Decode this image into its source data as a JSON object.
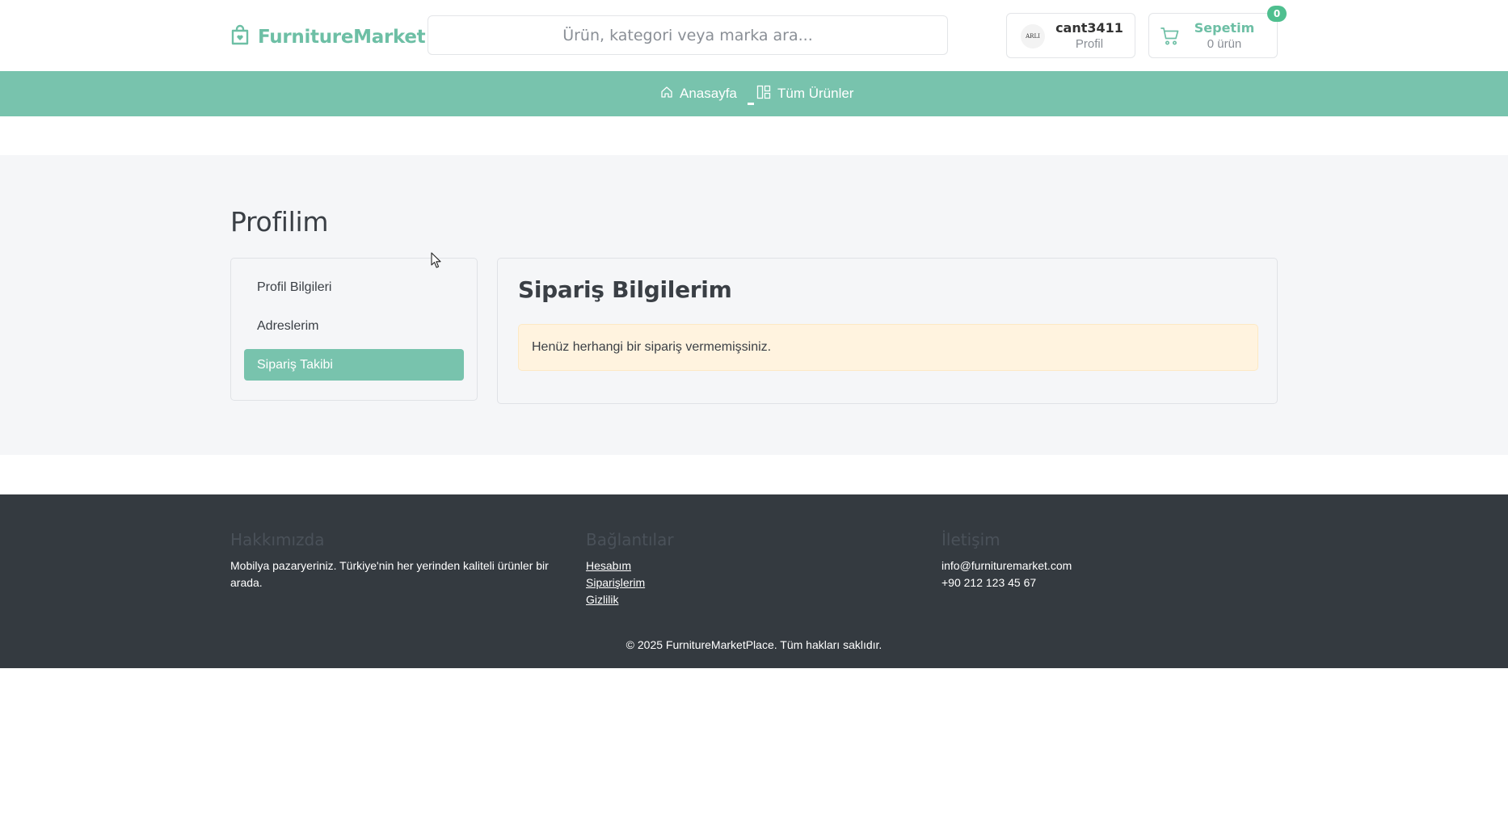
{
  "header": {
    "brand": "FurnitureMarket",
    "brand_color": "#6dbfa5",
    "brand_icon": "shopping-bag-icon",
    "search": {
      "placeholder": "Ürün, kategori veya marka ara...",
      "value": ""
    },
    "profile": {
      "username": "cant3411",
      "label": "Profil",
      "avatar_text": "ARLI"
    },
    "cart": {
      "title": "Sepetim",
      "subtitle": "0 ürün",
      "badge": "0",
      "icon": "cart-icon"
    }
  },
  "nav": {
    "color": "#78c3ad",
    "items": [
      {
        "label": "Anasayfa",
        "icon": "home-icon"
      },
      {
        "label": "Tüm Ürünler",
        "icon": "grid-icon"
      }
    ]
  },
  "main": {
    "title": "Profilim",
    "side_menu": [
      {
        "label": "Profil Bilgileri",
        "active": false
      },
      {
        "label": "Adreslerim",
        "active": false
      },
      {
        "label": "Sipariş Takibi",
        "active": true
      }
    ],
    "panel": {
      "title": "Sipariş Bilgilerim",
      "alert": "Henüz herhangi bir sipariş vermemişsiniz."
    }
  },
  "footer": {
    "about": {
      "heading": "Hakkımızda",
      "text": "Mobilya pazaryeriniz. Türkiye'nin her yerinden kaliteli ürünler bir arada."
    },
    "links": {
      "heading": "Bağlantılar",
      "items": [
        "Hesabım",
        "Siparişlerim",
        "Gizlilik"
      ]
    },
    "contact": {
      "heading": "İletişim",
      "email": "info@furnituremarket.com",
      "phone": "+90 212 123 45 67"
    },
    "copyright": "© 2025 FurnitureMarketPlace. Tüm hakları saklıdır."
  }
}
